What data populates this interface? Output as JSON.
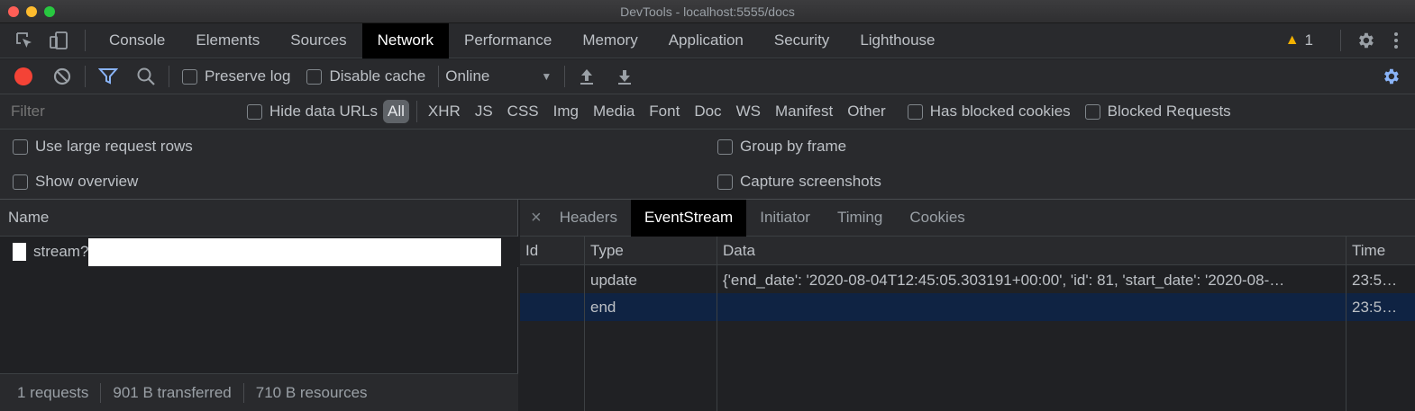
{
  "window": {
    "title": "DevTools - localhost:5555/docs"
  },
  "main_tabs": [
    "Console",
    "Elements",
    "Sources",
    "Network",
    "Performance",
    "Memory",
    "Application",
    "Security",
    "Lighthouse"
  ],
  "active_main_tab": "Network",
  "warnings_count": "1",
  "toolbar": {
    "preserve_log": "Preserve log",
    "disable_cache": "Disable cache",
    "throttling": "Online"
  },
  "filter": {
    "placeholder": "Filter",
    "hide_data_urls": "Hide data URLs",
    "types": [
      "All",
      "XHR",
      "JS",
      "CSS",
      "Img",
      "Media",
      "Font",
      "Doc",
      "WS",
      "Manifest",
      "Other"
    ],
    "has_blocked_cookies": "Has blocked cookies",
    "blocked_requests": "Blocked Requests"
  },
  "settings": {
    "use_large_rows": "Use large request rows",
    "show_overview": "Show overview",
    "group_by_frame": "Group by frame",
    "capture_screenshots": "Capture screenshots"
  },
  "requests": {
    "header": "Name",
    "items": [
      {
        "name": "stream?"
      }
    ]
  },
  "status_bar": {
    "requests": "1 requests",
    "transferred": "901 B transferred",
    "resources": "710 B resources"
  },
  "detail_tabs": [
    "Headers",
    "EventStream",
    "Initiator",
    "Timing",
    "Cookies"
  ],
  "active_detail_tab": "EventStream",
  "eventstream": {
    "columns": {
      "id": "Id",
      "type": "Type",
      "data": "Data",
      "time": "Time"
    },
    "rows": [
      {
        "id": "",
        "type": "update",
        "data": "{'end_date': '2020-08-04T12:45:05.303191+00:00', 'id': 81, 'start_date': '2020-08-…",
        "time": "23:5…"
      },
      {
        "id": "",
        "type": "end",
        "data": "",
        "time": "23:5…"
      }
    ]
  },
  "colors": {
    "accent_blue": "#8ab4f8",
    "record_red": "#f44336",
    "selected_row": "#0f2343",
    "warning": "#f2b100"
  }
}
